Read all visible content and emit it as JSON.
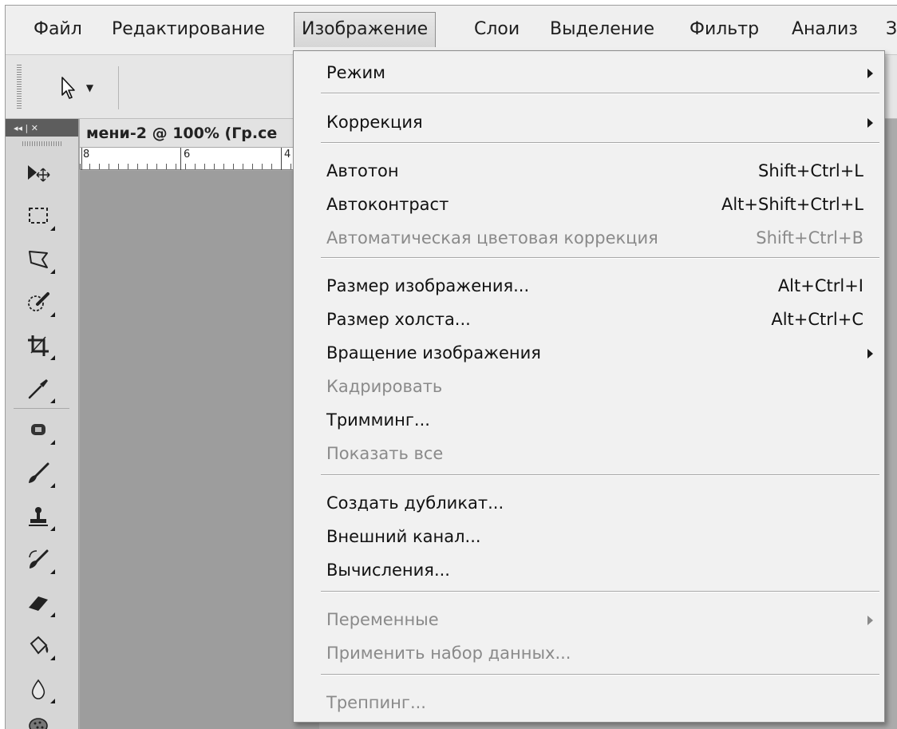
{
  "menubar": {
    "items": [
      {
        "label": "Файл"
      },
      {
        "label": "Редактирование"
      },
      {
        "label": "Изображение"
      },
      {
        "label": "Слои"
      },
      {
        "label": "Выделение"
      },
      {
        "label": "Фильтр"
      },
      {
        "label": "Анализ"
      },
      {
        "label": "З"
      }
    ],
    "active_index": 2
  },
  "options_bar": {
    "tool_icon": "arrow-pointer-icon",
    "dropdown_glyph": "▼"
  },
  "toolbox": {
    "header_glyphs": "◂◂ | ✕",
    "tools": [
      "move-tool-icon",
      "rect-marquee-icon",
      "lasso-icon",
      "quick-select-icon",
      "crop-icon",
      "eyedropper-icon",
      "healing-brush-icon",
      "brush-icon",
      "stamp-icon",
      "history-brush-icon",
      "eraser-icon",
      "paint-bucket-icon",
      "blur-icon",
      "sponge-icon"
    ]
  },
  "document": {
    "tab_title": "мени-2 @ 100% (Гр.се",
    "ruler_labels": [
      "8",
      "6",
      "4"
    ]
  },
  "menu": {
    "groups": [
      [
        {
          "label": "Режим",
          "shortcut": "",
          "submenu": true,
          "enabled": true
        }
      ],
      [
        {
          "label": "Коррекция",
          "shortcut": "",
          "submenu": true,
          "enabled": true
        }
      ],
      [
        {
          "label": "Автотон",
          "shortcut": "Shift+Ctrl+L",
          "submenu": false,
          "enabled": true
        },
        {
          "label": "Автоконтраст",
          "shortcut": "Alt+Shift+Ctrl+L",
          "submenu": false,
          "enabled": true
        },
        {
          "label": "Автоматическая цветовая коррекция",
          "shortcut": "Shift+Ctrl+B",
          "submenu": false,
          "enabled": false
        }
      ],
      [
        {
          "label": "Размер изображения...",
          "shortcut": "Alt+Ctrl+I",
          "submenu": false,
          "enabled": true
        },
        {
          "label": "Размер холста...",
          "shortcut": "Alt+Ctrl+C",
          "submenu": false,
          "enabled": true
        },
        {
          "label": "Вращение изображения",
          "shortcut": "",
          "submenu": true,
          "enabled": true
        },
        {
          "label": "Кадрировать",
          "shortcut": "",
          "submenu": false,
          "enabled": false
        },
        {
          "label": "Тримминг...",
          "shortcut": "",
          "submenu": false,
          "enabled": true
        },
        {
          "label": "Показать все",
          "shortcut": "",
          "submenu": false,
          "enabled": false
        }
      ],
      [
        {
          "label": "Создать дубликат...",
          "shortcut": "",
          "submenu": false,
          "enabled": true
        },
        {
          "label": "Внешний канал...",
          "shortcut": "",
          "submenu": false,
          "enabled": true
        },
        {
          "label": "Вычисления...",
          "shortcut": "",
          "submenu": false,
          "enabled": true
        }
      ],
      [
        {
          "label": "Переменные",
          "shortcut": "",
          "submenu": true,
          "enabled": false
        },
        {
          "label": "Применить набор данных...",
          "shortcut": "",
          "submenu": false,
          "enabled": false
        }
      ],
      [
        {
          "label": "Треппинг...",
          "shortcut": "",
          "submenu": false,
          "enabled": false
        }
      ]
    ]
  }
}
